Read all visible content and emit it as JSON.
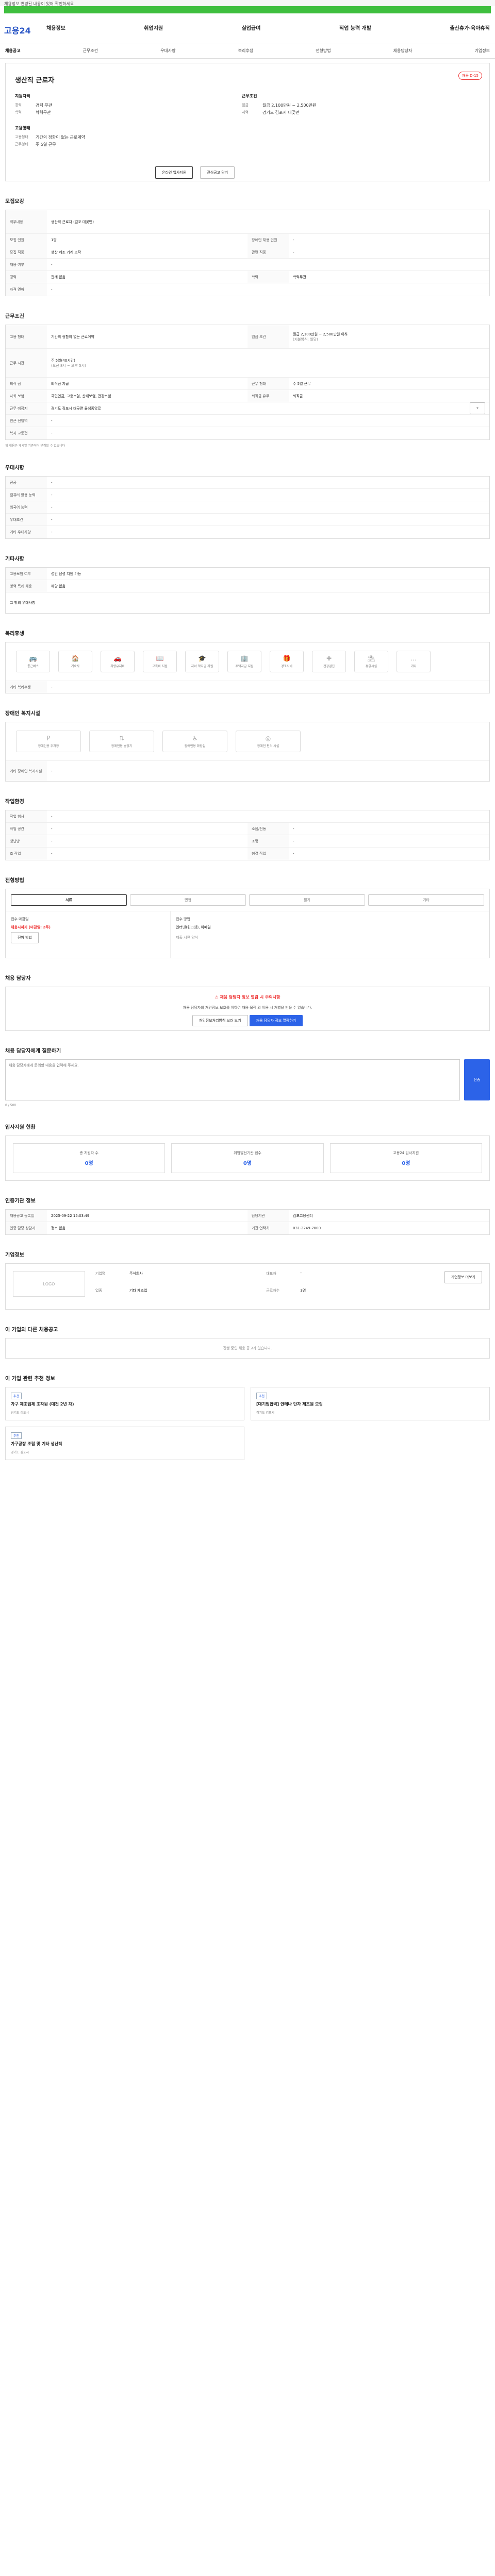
{
  "top_note": "채용정보 변경된 내용이 있어 확인하세요",
  "logo": "고용24",
  "nav": [
    "채용정보",
    "취업지원",
    "실업급여",
    "직업 능력 개발",
    "출산휴가·육아휴직"
  ],
  "tabs": [
    "채용공고",
    "근무조건",
    "우대사항",
    "복리후생",
    "전형방법",
    "채용담당자",
    "기업정보"
  ],
  "summary": {
    "title": "생산직 근로자",
    "badge": "채용 D-15",
    "job_label": "지원자격",
    "job_exp_k": "경력",
    "job_exp": "경력 무관",
    "job_edu_k": "학력",
    "job_edu": "학력무관",
    "cond_label": "근무조건",
    "wage_k": "임금",
    "wage": "월급 2,100만원 ~ 2,500만원",
    "loc_k": "지역",
    "loc": "경기도 김포시 대곶면",
    "dept_label": "고용형태",
    "emp_k": "고용형태",
    "emp": "기간의 정함이 없는 근로계약",
    "hours_k": "근무형태",
    "hours": "주 5일 근무",
    "btn_apply": "온라인 입사지원",
    "btn_fav": "관심공고 담기"
  },
  "recruit": {
    "h": "모집요강",
    "intro_k": "직무내용",
    "intro": "생산직 근로자 (김포 대곶면)",
    "rows": [
      [
        "모집 인원",
        "1명",
        "장애인 채용 인원",
        "-"
      ],
      [
        "모집 직종",
        "생산 제조 기계 조작",
        "관련 직종",
        "-"
      ],
      [
        "채용 여부",
        "-",
        "",
        ""
      ],
      [
        "경력",
        "관계 없음",
        "학력",
        "학력무관"
      ],
      [
        "자격 면허",
        "-",
        "",
        ""
      ]
    ]
  },
  "cond": {
    "h": "근무조건",
    "emp_k": "고용 형태",
    "emp": "기간의 정함이 없는 근로계약",
    "wage_k": "임금 조건",
    "wage": "월급 2,100만원 ~ 2,500만원 이하",
    "wage2": "(지불방식: 일당)",
    "hours_k": "근무 시간",
    "hours": "주 5일(40시간)",
    "shift": "(오전 8시 ~ 오후 5시)",
    "rows": [
      [
        "퇴직 금",
        "퇴직금 지급",
        "근무 형태",
        "주 5일 근무"
      ],
      [
        "사회 보험",
        "국민연금, 고용보험, 산재보험, 건강보험",
        "퇴직금 유무",
        "퇴직금"
      ],
      [
        "근무 예정지",
        "경기도 김포시 대곶면 율생중앙로",
        "",
        ""
      ],
      [
        "인근 전철역",
        "-",
        "",
        ""
      ],
      [
        "복지 교통편",
        "-",
        "",
        ""
      ]
    ],
    "note": "위 내용은 게시일 기준이며 변경될 수 있습니다"
  },
  "pref": {
    "h": "우대사항",
    "rows": [
      [
        "전공",
        "-"
      ],
      [
        "컴퓨터 활용 능력",
        "-"
      ],
      [
        "외국어 능력",
        "-"
      ],
      [
        "우대조건",
        "-"
      ],
      [
        "기타 우대사항",
        "-"
      ]
    ]
  },
  "etc": {
    "h": "기타사항",
    "rows": [
      [
        "고용보험 여부",
        "성인 남성 지원 가능"
      ],
      [
        "병역 특례 채용",
        "해당 없음"
      ]
    ],
    "sub": "그 밖의 우대사항"
  },
  "welfare": {
    "h": "복리후생",
    "items": [
      "통근버스",
      "기숙사",
      "차량유지비",
      "교육비 지원",
      "자녀 학자금 지원",
      "주택자금 지원",
      "경조사비",
      "건강검진",
      "휴양시설",
      "기타"
    ],
    "etc_k": "기타 복리후생"
  },
  "disabled": {
    "h": "장애인 복지시설",
    "items": [
      "장애인용 주차장",
      "장애인용 승강기",
      "장애인용 화장실",
      "장애인 편의 시설"
    ],
    "etc_k": "기타 장애인 복지시설"
  },
  "workplace": {
    "h": "작업환경",
    "rows": [
      [
        "작업 행사",
        "-",
        "",
        ""
      ],
      [
        "작업 공간",
        "-",
        "소음/진동",
        "-"
      ],
      [
        "냉난방",
        "-",
        "조명",
        "-"
      ],
      [
        "조 작업",
        "-",
        "청결 작업",
        "-"
      ]
    ]
  },
  "method": {
    "h": "전형방법",
    "tabs": [
      "서류",
      "면접",
      "필기",
      "기타"
    ],
    "recv_k": "접수 마감일",
    "recv": "채용시까지 (마감일: 2주)",
    "doc_k": "접수 방법",
    "doc": "인터넷(워크넷), 이메일",
    "fax": "제출 서류 양식",
    "btn": "전형 방법"
  },
  "contact": {
    "h": "채용 담당자",
    "warn": "채용 담당자 정보 열람 시 주의사항",
    "desc": "채용 담당자의 개인정보 보호를 위하여 채용 목적 외 이용 시 처벌을 받을 수 있습니다.",
    "btn1": "개인정보처리방침 보러 보기",
    "btn2": "채용 담당자 정보 열람하기"
  },
  "inquiry": {
    "h": "채용 담당자에게 질문하기",
    "placeholder": "채용 담당자에게 문의할 내용을 입력해 주세요.",
    "count": "0 / 500",
    "send": "전송"
  },
  "stats": {
    "h": "입사지원 현황",
    "items": [
      [
        "총 지원자 수",
        "0명"
      ],
      [
        "취업알선기관 접수",
        "0명"
      ],
      [
        "고용24 입사지원",
        "0명"
      ]
    ]
  },
  "agency": {
    "h": "인증기관 정보",
    "rows": [
      [
        "채용공고 등록일",
        "2025-09-22 15:03:49",
        "담당기관",
        "김포고용센터"
      ],
      [
        "인증 담당 상담자",
        "정보 없음",
        "기관 연락처",
        "031-2249-7000"
      ]
    ]
  },
  "company": {
    "h": "기업정보",
    "logo": "LOGO",
    "name_k": "기업명",
    "name": "주식회사",
    "rep_k": "대표자",
    "rep": "-",
    "biz_k": "업종",
    "biz": "기타 제조업",
    "emp_k": "근로자수",
    "emp": "3명",
    "btn": "기업정보 더보기"
  },
  "similar": {
    "h": "이 기업의 다른 채용공고",
    "empty": "진행 중인 채용 공고가 없습니다."
  },
  "recommend": {
    "h": "이 기업 관련 추천 정보",
    "jobs": [
      {
        "tag": "추천",
        "title": "가구 제조업체 조작원 (대전 2년 차)",
        "meta": "경기도 김포시"
      },
      {
        "tag": "추천",
        "title": "[대기업협력] 안테나 단자 제조원 모집",
        "meta": "경기도 김포시"
      },
      {
        "tag": "추천",
        "title": "가구공장 조립 및 기타 생산직",
        "meta": "경기도 김포시"
      }
    ]
  }
}
